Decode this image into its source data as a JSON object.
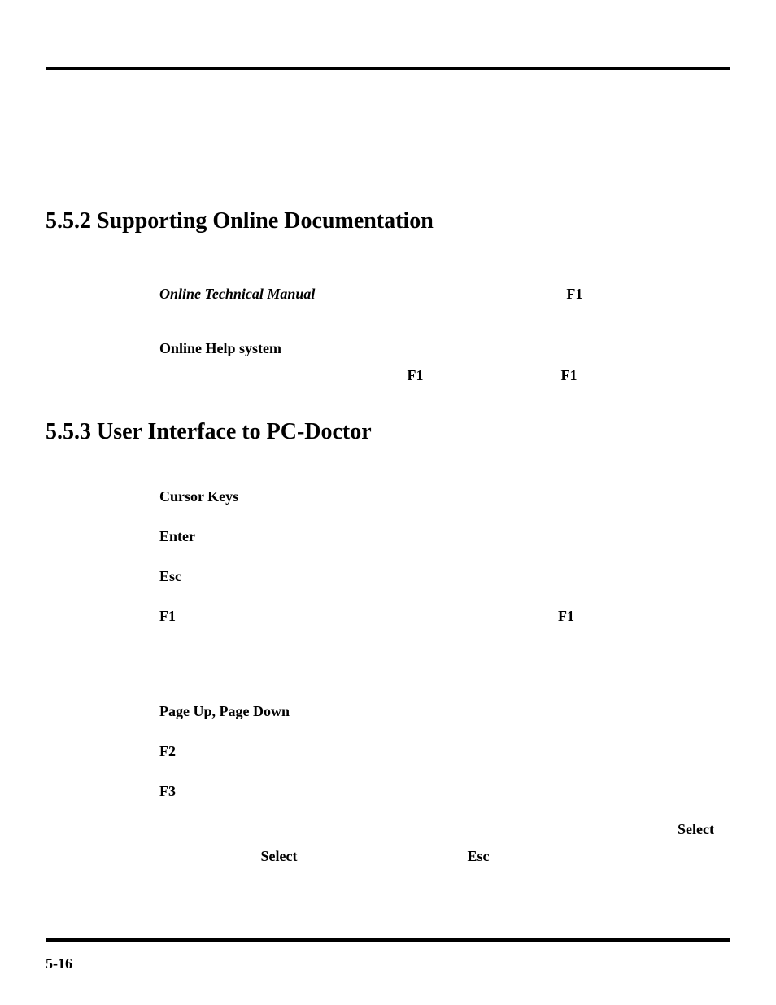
{
  "footer": {
    "page": "5-16"
  },
  "sec552": {
    "heading": "5.5.2  Supporting Online Documentation",
    "item1": {
      "title": "Online Technical Manual",
      "key": "F1"
    },
    "item2": {
      "title": "Online Help system",
      "key_a": "F1",
      "key_b": "F1"
    }
  },
  "sec553": {
    "heading": "5.5.3  User Interface to PC-Doctor",
    "rows": [
      {
        "term": "Cursor Keys",
        "desc": ""
      },
      {
        "term": "Enter",
        "desc": ""
      },
      {
        "term": "Esc",
        "desc": ""
      }
    ],
    "f1row": {
      "term": "F1",
      "key": "F1"
    },
    "rows2": [
      {
        "term": "Page Up, Page Down",
        "desc": ""
      },
      {
        "term": "F2",
        "desc": ""
      },
      {
        "term": "F3",
        "desc": ""
      }
    ],
    "tail": {
      "select1": "Select",
      "select2": "Select",
      "esc": "Esc"
    }
  }
}
